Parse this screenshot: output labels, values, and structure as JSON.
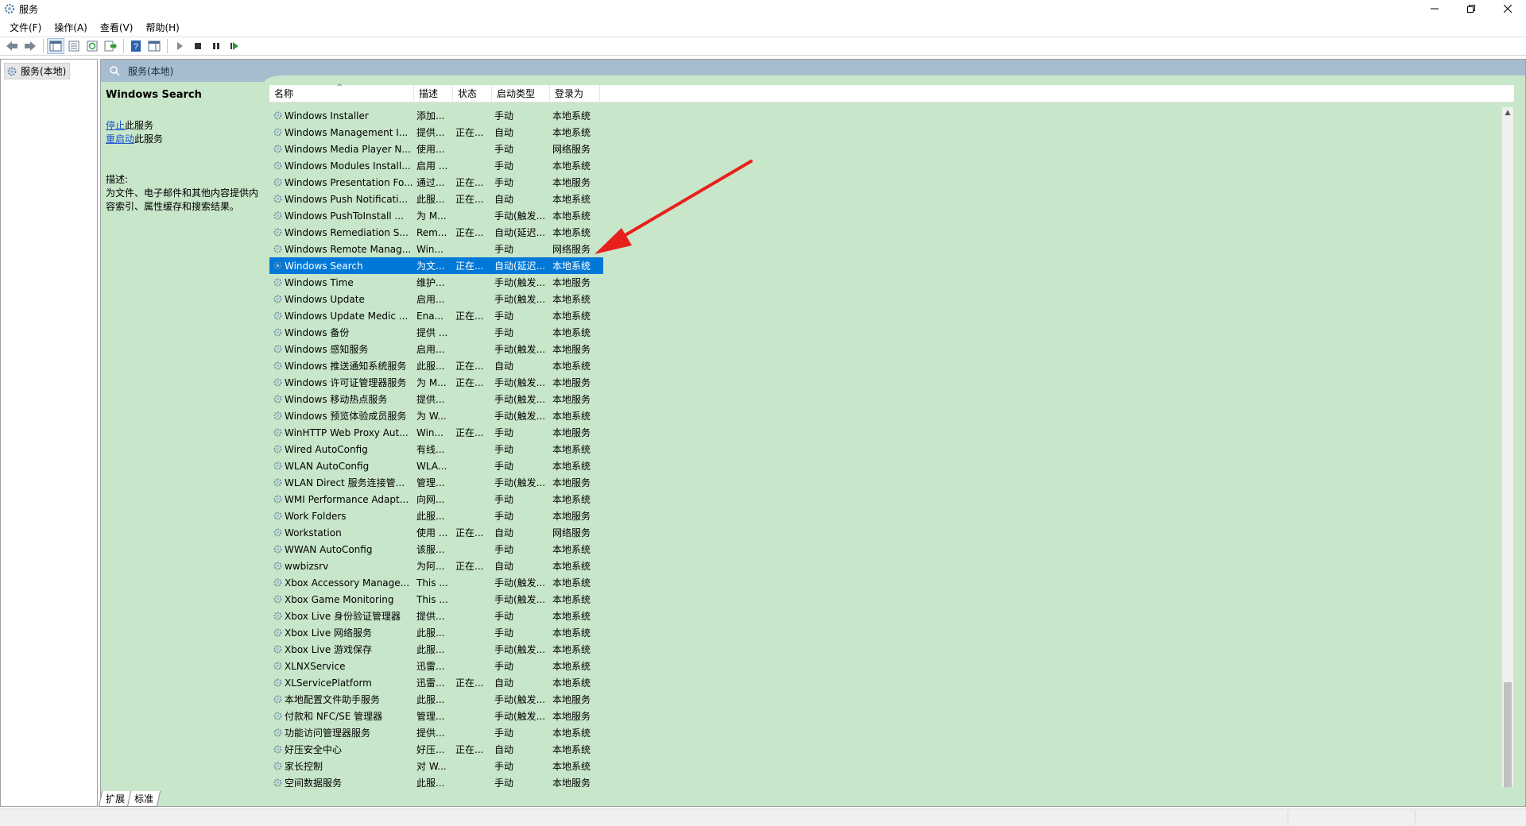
{
  "window": {
    "title": "服务"
  },
  "menu": [
    "文件(F)",
    "操作(A)",
    "查看(V)",
    "帮助(H)"
  ],
  "tree": {
    "root_label": "服务(本地)"
  },
  "panel": {
    "header": "服务(本地)"
  },
  "description_pane": {
    "service_name": "Windows Search",
    "stop_link": "停止",
    "stop_suffix": "此服务",
    "restart_link": "重启动",
    "restart_suffix": "此服务",
    "desc_label": "描述:",
    "desc_text": "为文件、电子邮件和其他内容提供内容索引、属性缓存和搜索结果。"
  },
  "table": {
    "columns": [
      "名称",
      "描述",
      "状态",
      "启动类型",
      "登录为"
    ],
    "rows": [
      [
        "Windows Installer",
        "添加...",
        "",
        "手动",
        "本地系统"
      ],
      [
        "Windows Management I...",
        "提供...",
        "正在...",
        "自动",
        "本地系统"
      ],
      [
        "Windows Media Player N...",
        "使用...",
        "",
        "手动",
        "网络服务"
      ],
      [
        "Windows Modules Install...",
        "启用 ...",
        "",
        "手动",
        "本地系统"
      ],
      [
        "Windows Presentation Fo...",
        "通过...",
        "正在...",
        "手动",
        "本地服务"
      ],
      [
        "Windows Push Notificati...",
        "此服...",
        "正在...",
        "自动",
        "本地系统"
      ],
      [
        "Windows PushToInstall ...",
        "为 M...",
        "",
        "手动(触发...",
        "本地系统"
      ],
      [
        "Windows Remediation S...",
        "Rem...",
        "正在...",
        "自动(延迟...",
        "本地系统"
      ],
      [
        "Windows Remote Manag...",
        "Win...",
        "",
        "手动",
        "网络服务"
      ],
      [
        "Windows Search",
        "为文...",
        "正在...",
        "自动(延迟...",
        "本地系统"
      ],
      [
        "Windows Time",
        "维护...",
        "",
        "手动(触发...",
        "本地服务"
      ],
      [
        "Windows Update",
        "启用...",
        "",
        "手动(触发...",
        "本地系统"
      ],
      [
        "Windows Update Medic ...",
        "Ena...",
        "正在...",
        "手动",
        "本地系统"
      ],
      [
        "Windows 备份",
        "提供 ...",
        "",
        "手动",
        "本地系统"
      ],
      [
        "Windows 感知服务",
        "启用...",
        "",
        "手动(触发...",
        "本地服务"
      ],
      [
        "Windows 推送通知系统服务",
        "此服...",
        "正在...",
        "自动",
        "本地系统"
      ],
      [
        "Windows 许可证管理器服务",
        "为 M...",
        "正在...",
        "手动(触发...",
        "本地服务"
      ],
      [
        "Windows 移动热点服务",
        "提供...",
        "",
        "手动(触发...",
        "本地服务"
      ],
      [
        "Windows 预览体验成员服务",
        "为 W...",
        "",
        "手动(触发...",
        "本地系统"
      ],
      [
        "WinHTTP Web Proxy Aut...",
        "Win...",
        "正在...",
        "手动",
        "本地服务"
      ],
      [
        "Wired AutoConfig",
        "有线...",
        "",
        "手动",
        "本地系统"
      ],
      [
        "WLAN AutoConfig",
        "WLA...",
        "",
        "手动",
        "本地系统"
      ],
      [
        "WLAN Direct 服务连接管...",
        "管理...",
        "",
        "手动(触发...",
        "本地服务"
      ],
      [
        "WMI Performance Adapt...",
        "向网...",
        "",
        "手动",
        "本地系统"
      ],
      [
        "Work Folders",
        "此服...",
        "",
        "手动",
        "本地服务"
      ],
      [
        "Workstation",
        "使用 ...",
        "正在...",
        "自动",
        "网络服务"
      ],
      [
        "WWAN AutoConfig",
        "该服...",
        "",
        "手动",
        "本地系统"
      ],
      [
        "wwbizsrv",
        "为阿...",
        "正在...",
        "自动",
        "本地系统"
      ],
      [
        "Xbox Accessory Manage...",
        "This ...",
        "",
        "手动(触发...",
        "本地系统"
      ],
      [
        "Xbox Game Monitoring",
        "This ...",
        "",
        "手动(触发...",
        "本地系统"
      ],
      [
        "Xbox Live 身份验证管理器",
        "提供...",
        "",
        "手动",
        "本地系统"
      ],
      [
        "Xbox Live 网络服务",
        "此服...",
        "",
        "手动",
        "本地系统"
      ],
      [
        "Xbox Live 游戏保存",
        "此服...",
        "",
        "手动(触发...",
        "本地系统"
      ],
      [
        "XLNXService",
        "迅雷...",
        "",
        "手动",
        "本地系统"
      ],
      [
        "XLServicePlatform",
        "迅雷...",
        "正在...",
        "自动",
        "本地系统"
      ],
      [
        "本地配置文件助手服务",
        "此服...",
        "",
        "手动(触发...",
        "本地服务"
      ],
      [
        "付款和 NFC/SE 管理器",
        "管理...",
        "",
        "手动(触发...",
        "本地服务"
      ],
      [
        "功能访问管理器服务",
        "提供...",
        "",
        "手动",
        "本地系统"
      ],
      [
        "好压安全中心",
        "好压...",
        "正在...",
        "自动",
        "本地系统"
      ],
      [
        "家长控制",
        "对 W...",
        "",
        "手动",
        "本地系统"
      ],
      [
        "空间数据服务",
        "此服...",
        "",
        "手动",
        "本地服务"
      ]
    ],
    "selected_index": 9
  },
  "tabs": [
    "扩展",
    "标准"
  ],
  "colors": {
    "selection": "#0078d7",
    "panel_bg": "#c8e6c9",
    "header_bg": "#a6bccf",
    "annotation": "#e8201c"
  }
}
